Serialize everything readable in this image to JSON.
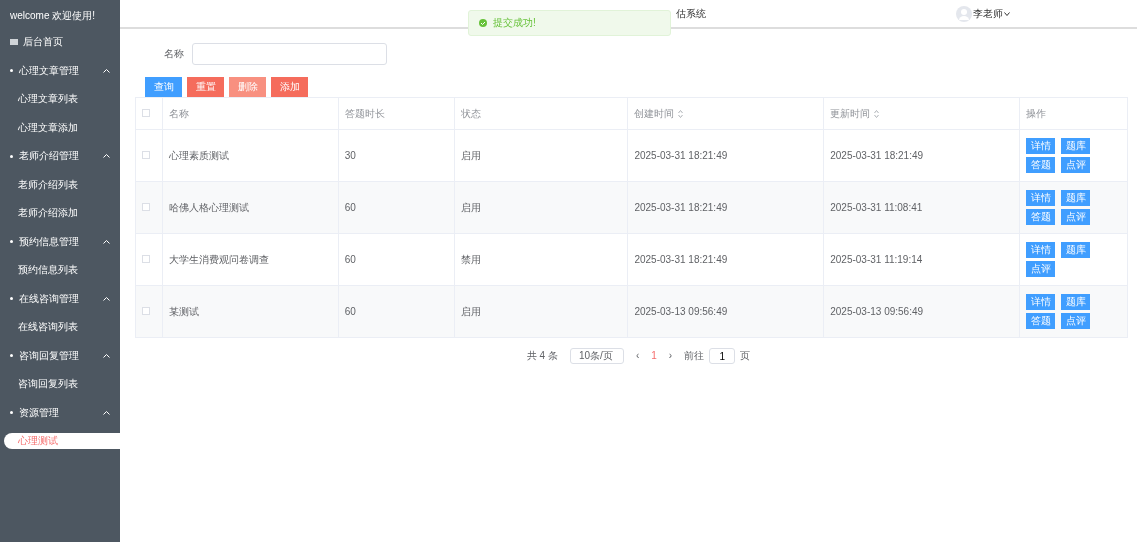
{
  "sidebar": {
    "welcome": "welcome 欢迎使用!",
    "home": "后台首页",
    "groups": [
      {
        "label": "心理文章管理",
        "expanded": true,
        "children": [
          {
            "label": "心理文章列表",
            "selected": false
          },
          {
            "label": "心理文章添加",
            "selected": false
          }
        ]
      },
      {
        "label": "老师介绍管理",
        "expanded": true,
        "children": [
          {
            "label": "老师介绍列表",
            "selected": false
          },
          {
            "label": "老师介绍添加",
            "selected": false
          }
        ]
      },
      {
        "label": "预约信息管理",
        "expanded": true,
        "children": [
          {
            "label": "预约信息列表",
            "selected": false
          }
        ]
      },
      {
        "label": "在线咨询管理",
        "expanded": true,
        "children": [
          {
            "label": "在线咨询列表",
            "selected": false
          }
        ]
      },
      {
        "label": "咨询回复管理",
        "expanded": true,
        "children": [
          {
            "label": "咨询回复列表",
            "selected": false
          }
        ]
      },
      {
        "label": "资源管理",
        "expanded": true,
        "children": [
          {
            "label": "心理测试",
            "selected": true
          }
        ]
      }
    ]
  },
  "header": {
    "title": "估系统",
    "user": "李老师"
  },
  "toast": {
    "message": "提交成功!"
  },
  "search": {
    "label": "名称"
  },
  "buttons": [
    {
      "label": "查询",
      "kind": "primary"
    },
    {
      "label": "重置",
      "kind": "danger"
    },
    {
      "label": "删除",
      "kind": "danger-light"
    },
    {
      "label": "添加",
      "kind": "danger"
    }
  ],
  "table": {
    "header_checked": false,
    "columns": [
      {
        "label": "名称",
        "sortable": false
      },
      {
        "label": "答题时长",
        "sortable": false
      },
      {
        "label": "状态",
        "sortable": false
      },
      {
        "label": "创建时间",
        "sortable": true
      },
      {
        "label": "更新时间",
        "sortable": true
      },
      {
        "label": "操作",
        "sortable": false
      }
    ],
    "rows": [
      {
        "checked": false,
        "cells": [
          "心理素质测试",
          "30",
          "启用",
          "2025-03-31 18:21:49",
          "2025-03-31 18:21:49"
        ],
        "actions": [
          "详情",
          "题库",
          "答题",
          "点评"
        ]
      },
      {
        "checked": false,
        "cells": [
          "哈佛人格心理测试",
          "60",
          "启用",
          "2025-03-31 18:21:49",
          "2025-03-31 11:08:41"
        ],
        "actions": [
          "详情",
          "题库",
          "答题",
          "点评"
        ]
      },
      {
        "checked": false,
        "cells": [
          "大学生消费观问卷调查",
          "60",
          "禁用",
          "2025-03-31 18:21:49",
          "2025-03-31 11:19:14"
        ],
        "actions": [
          "详情",
          "题库",
          "点评"
        ]
      },
      {
        "checked": false,
        "cells": [
          "某测试",
          "60",
          "启用",
          "2025-03-13 09:56:49",
          "2025-03-13 09:56:49"
        ],
        "actions": [
          "详情",
          "题库",
          "答题",
          "点评"
        ]
      }
    ]
  },
  "pagination": {
    "total": "共 4 条",
    "page_size": "10条/页",
    "prev": "‹",
    "pages": [
      {
        "label": "1",
        "selected": true
      }
    ],
    "next": "›",
    "goto_label": "前往",
    "goto_value": "1",
    "goto_suffix": "页"
  }
}
